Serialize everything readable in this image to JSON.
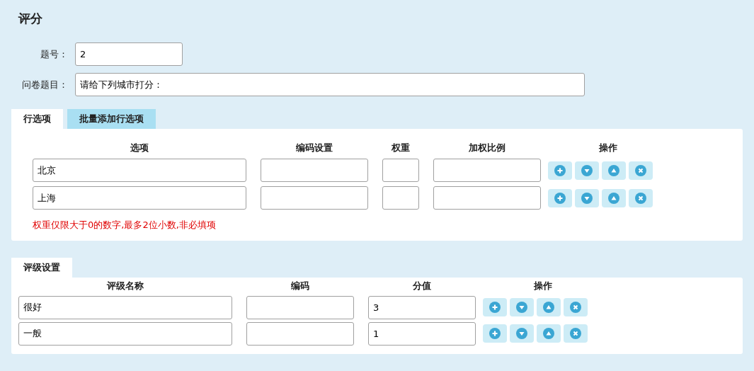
{
  "title": "评分",
  "fields": [
    {
      "label": "题号：",
      "value": "2",
      "kind": "short"
    },
    {
      "label": "问卷题目：",
      "value": "请给下列城市打分：",
      "kind": "long"
    }
  ],
  "row_tabs": [
    {
      "label": "行选项",
      "selected": true
    },
    {
      "label": "批量添加行选项",
      "selected": false
    }
  ],
  "row_columns": [
    "选项",
    "编码设置",
    "权重",
    "加权比例",
    "操作"
  ],
  "row_options": [
    {
      "option": "北京"
    },
    {
      "option": "上海"
    }
  ],
  "hint": "权重仅限大于0的数字,最多2位小数,非必填项",
  "rating_tabs": [
    {
      "label": "评级设置",
      "selected": true
    }
  ],
  "rating_columns": [
    "评级名称",
    "编码",
    "分值",
    "操作"
  ],
  "ratings": [
    {
      "name": "很好",
      "score": "3"
    },
    {
      "name": "一般",
      "score": "1"
    }
  ]
}
